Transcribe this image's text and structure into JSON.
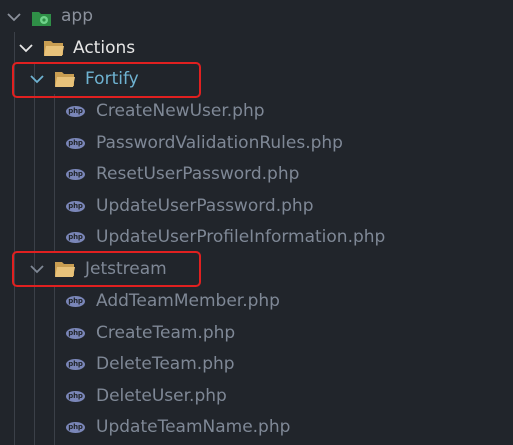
{
  "root": {
    "label": "app",
    "icon": "app-folder-icon"
  },
  "actions": {
    "label": "Actions",
    "icon": "folder-open-icon"
  },
  "fortify": {
    "label": "Fortify",
    "files": [
      "CreateNewUser.php",
      "PasswordValidationRules.php",
      "ResetUserPassword.php",
      "UpdateUserPassword.php",
      "UpdateUserProfileInformation.php"
    ]
  },
  "jetstream": {
    "label": "Jetstream",
    "files": [
      "AddTeamMember.php",
      "CreateTeam.php",
      "DeleteTeam.php",
      "DeleteUser.php",
      "UpdateTeamName.php"
    ]
  },
  "file_icon_text": "php",
  "colors": {
    "background": "#21252b",
    "root_label": "#8b919c",
    "actions_label": "#e6e6e6",
    "folder_label": "#6fb3d2",
    "file_label": "#7f8896",
    "folder_icon": "#e8c27a",
    "php_badge": "#7a86b8",
    "highlight": "#e02020",
    "app_icon": "#3aa655"
  }
}
